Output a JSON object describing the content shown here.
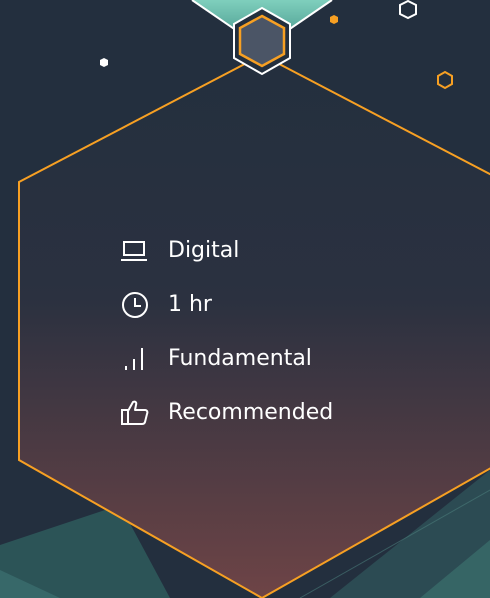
{
  "course_details": {
    "items": [
      {
        "icon": "laptop-icon",
        "label": "Digital"
      },
      {
        "icon": "clock-icon",
        "label": "1 hr"
      },
      {
        "icon": "signal-bars-icon",
        "label": "Fundamental"
      },
      {
        "icon": "thumbs-up-icon",
        "label": "Recommended"
      }
    ]
  },
  "colors": {
    "background": "#232f3e",
    "accent_orange": "#f7a023",
    "accent_teal": "#5fb3a3",
    "text": "#ffffff"
  }
}
